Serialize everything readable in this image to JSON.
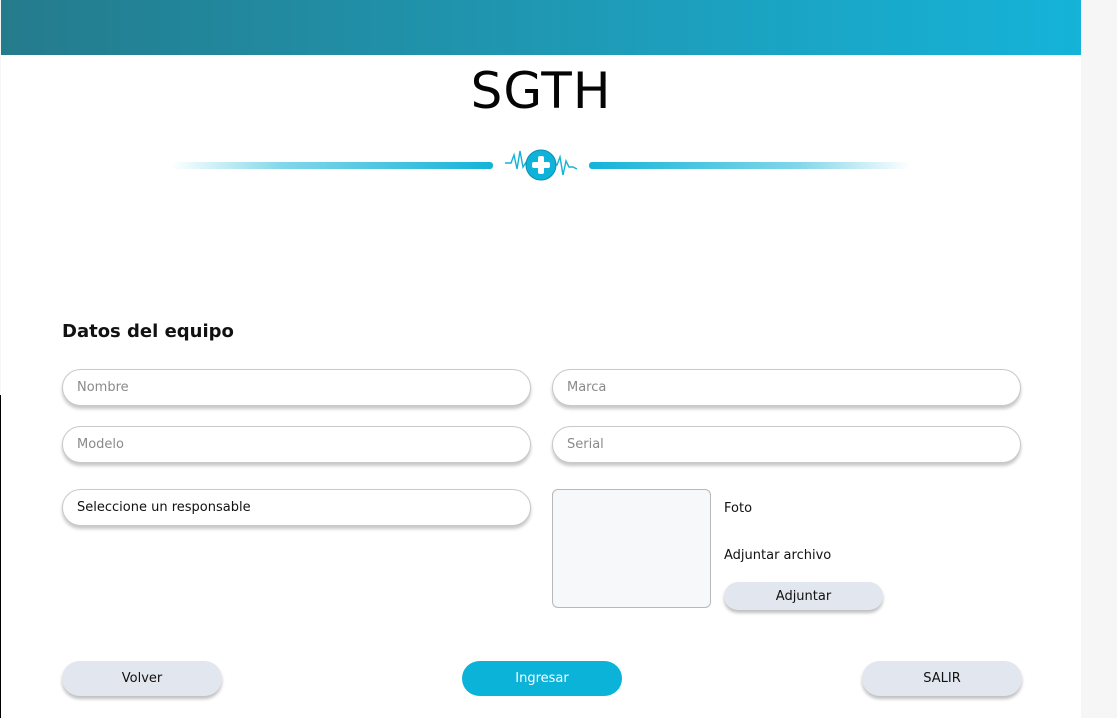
{
  "header": {
    "brand": "SGTH"
  },
  "form": {
    "section_title": "Datos del equipo",
    "nombre_placeholder": "Nombre",
    "marca_placeholder": "Marca",
    "modelo_placeholder": "Modelo",
    "serial_placeholder": "Serial",
    "responsable_selected": "Seleccione un responsable",
    "photo_label": "Foto",
    "attach_label": "Adjuntar archivo",
    "attach_button": "Adjuntar"
  },
  "actions": {
    "back": "Volver",
    "submit": "Ingresar",
    "exit": "SALIR"
  },
  "colors": {
    "accent": "#0bb3d9",
    "header_start": "#247b8c",
    "header_end": "#15b3d9",
    "button_gray": "#e2e6ee"
  },
  "icons": {
    "emblem": "medical-cross-heartbeat-icon"
  }
}
